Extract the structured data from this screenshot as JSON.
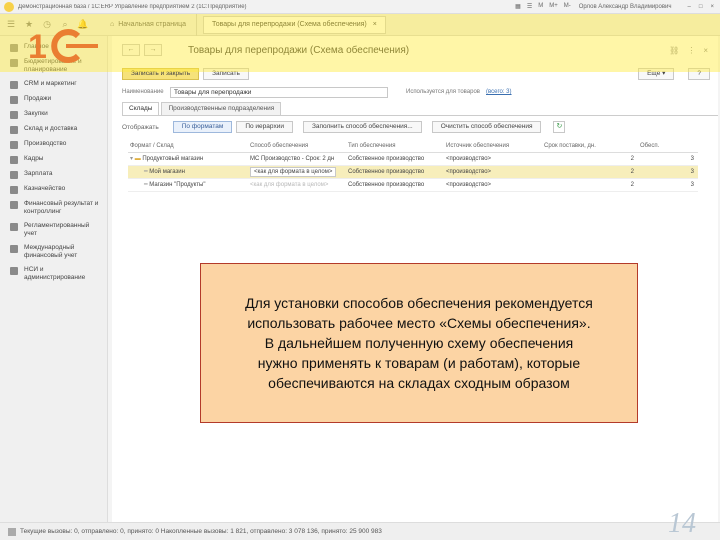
{
  "window": {
    "title": "Демонстрационная база / 1С:ERP Управление предприятием 2  (1С:Предприятие)",
    "user": "Орлов Александр Владимирович"
  },
  "tabs_bar": {
    "home_label": "Начальная страница",
    "active_tab_label": "Товары для перепродажи (Схема обеспечения)",
    "close_symbol": "×"
  },
  "sidebar": {
    "items": [
      {
        "label": "Главное",
        "icon": "menu-icon"
      },
      {
        "label": "Бюджетирование и планирование",
        "icon": "chart-icon"
      },
      {
        "label": "CRM и маркетинг",
        "icon": "crm-icon"
      },
      {
        "label": "Продажи",
        "icon": "sales-icon"
      },
      {
        "label": "Закупки",
        "icon": "purchase-icon"
      },
      {
        "label": "Склад и доставка",
        "icon": "warehouse-icon"
      },
      {
        "label": "Производство",
        "icon": "production-icon"
      },
      {
        "label": "Кадры",
        "icon": "people-icon"
      },
      {
        "label": "Зарплата",
        "icon": "salary-icon"
      },
      {
        "label": "Казначейство",
        "icon": "treasury-icon"
      },
      {
        "label": "Финансовый результат и контроллинг",
        "icon": "finance-icon"
      },
      {
        "label": "Регламентированный учет",
        "icon": "ledger-icon"
      },
      {
        "label": "Международный финансовый учет",
        "icon": "international-icon"
      },
      {
        "label": "НСИ и администрирование",
        "icon": "admin-icon"
      }
    ]
  },
  "document": {
    "title": "Товары для перепродажи (Схема обеспечения)",
    "nav_back": "←",
    "nav_forward": "→",
    "save_close_label": "Записать и закрыть",
    "save_label": "Записать",
    "more_label": "Еще ▾",
    "help_label": "?",
    "name_label": "Наименование",
    "name_value": "Товары для перепродажи",
    "used_label": "Используется для товаров",
    "used_link": "(всего: 3)",
    "tabs": [
      "Склады",
      "Производственные подразделения"
    ],
    "filter_label": "Отображать",
    "filter_buttons": [
      "По форматам",
      "По иерархии"
    ],
    "fill_button": "Заполнить способ обеспечения...",
    "clear_button": "Очистить способ обеспечения"
  },
  "table": {
    "columns": [
      "Формат / Склад",
      "Способ обеспечения",
      "Тип обеспечения",
      "Источник обеспечения",
      "Срок поставки, дн.",
      "Обесп."
    ],
    "rows": [
      {
        "name": "Продуктовый магазин",
        "method": "МС Производство - Срок: 2 дн",
        "type": "Собственное производство",
        "source": "<производство>",
        "days": "2",
        "prov": "3"
      },
      {
        "name": "Мой магазин",
        "method": "<как для формата в целом>",
        "type": "Собственное производство",
        "source": "<производство>",
        "days": "2",
        "prov": "3"
      },
      {
        "name": "Магазин \"Продукты\"",
        "method": "<как для формата в целом>",
        "type": "Собственное производство",
        "source": "<производство>",
        "days": "2",
        "prov": "3"
      }
    ]
  },
  "statusbar": {
    "text": "Текущие вызовы: 0, отправлено: 0, принято: 0   Накопленные вызовы: 1 821, отправлено: 3 078 136, принято: 25 900 983"
  },
  "callout": {
    "lines": [
      "Для установки способов обеспечения рекомендуется",
      "использовать рабочее место «Схемы обеспечения».",
      "В дальнейшем полученную схему обеспечения",
      "нужно применять к товарам (и работам), которые",
      "обеспечиваются на складах сходным образом"
    ]
  },
  "slide_number": "14",
  "colors": {
    "highlight": "#ffec3c",
    "callout_bg": "#fcd4a4",
    "callout_border": "#b33a2a",
    "primary_button": "#f6e27a",
    "row_highlight": "#f7eebb"
  }
}
